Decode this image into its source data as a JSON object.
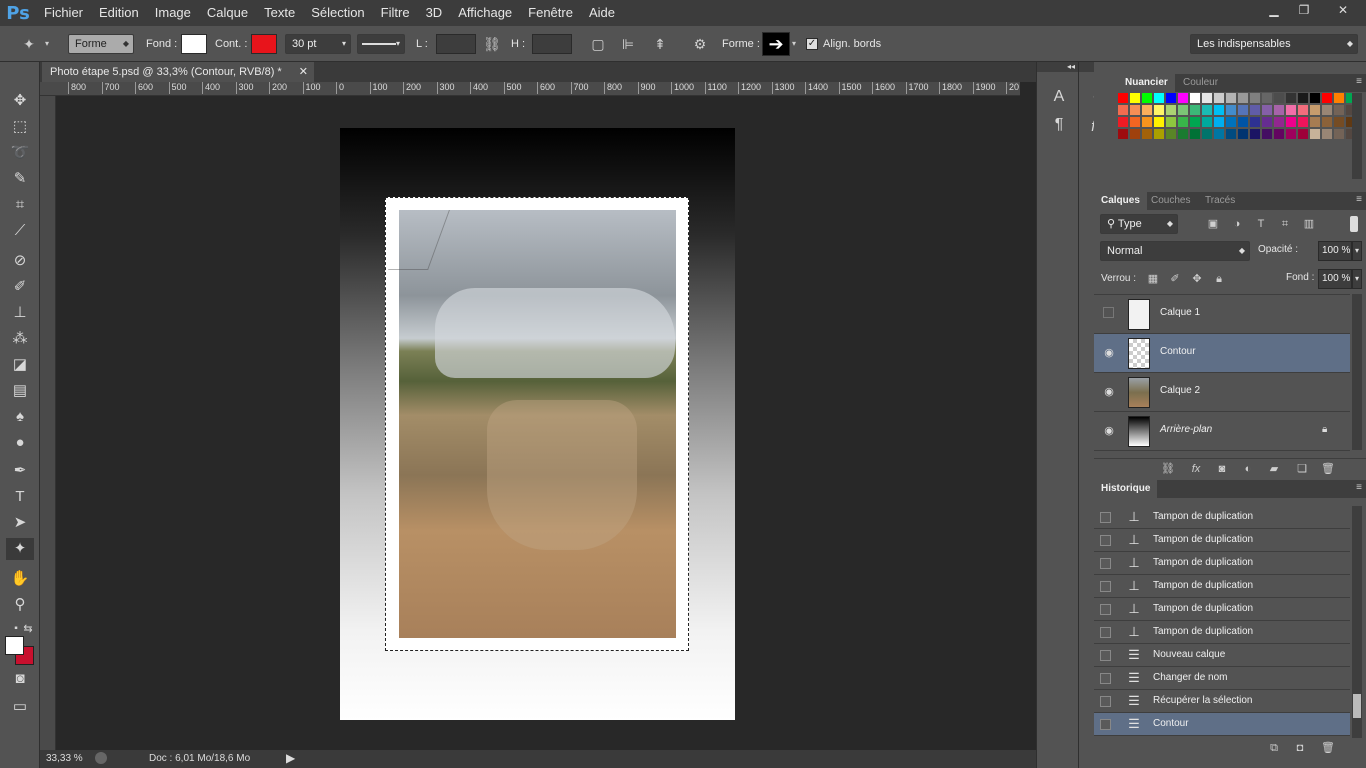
{
  "app": {
    "logo": "Ps"
  },
  "menu": [
    "Fichier",
    "Edition",
    "Image",
    "Calque",
    "Texte",
    "Sélection",
    "Filtre",
    "3D",
    "Affichage",
    "Fenêtre",
    "Aide"
  ],
  "window_controls": [
    "minimize-icon",
    "restore-icon",
    "close-icon"
  ],
  "options": {
    "mode": "Forme",
    "fill_label": "Fond :",
    "stroke_label": "Cont. :",
    "stroke_color": "#e8141b",
    "fill_color": "#ffffff",
    "stroke_width": "30 pt",
    "w_label": "L :",
    "h_label": "H :",
    "shape_label": "Forme :",
    "align_label": "Align. bords",
    "workspace": "Les indispensables"
  },
  "document": {
    "tab_title": "Photo étape 5.psd @ 33,3% (Contour, RVB/8) *",
    "zoom": "33,33 %",
    "doc_info": "Doc : 6,01 Mo/18,6 Mo"
  },
  "ruler_ticks": [
    "800",
    "700",
    "600",
    "500",
    "400",
    "300",
    "200",
    "100",
    "0",
    "100",
    "200",
    "300",
    "400",
    "500",
    "600",
    "700",
    "800",
    "900",
    "1000",
    "1100",
    "1200",
    "1300",
    "1400",
    "1500",
    "1600",
    "1700",
    "1800",
    "1900",
    "20"
  ],
  "swatch_panel": {
    "tabs": [
      "Nuancier",
      "Couleur"
    ],
    "colors": [
      "#ff0000",
      "#ffff00",
      "#00ff00",
      "#00ffff",
      "#0000ff",
      "#ff00ff",
      "#ffffff",
      "#e6e6e6",
      "#cccccc",
      "#b3b3b3",
      "#999999",
      "#808080",
      "#666666",
      "#4d4d4d",
      "#333333",
      "#1a1a1a",
      "#000000",
      "#ff0000",
      "#ff8000",
      "#00a651",
      "#f26c4f",
      "#f68e55",
      "#fbaf5c",
      "#fff467",
      "#acd372",
      "#7cc576",
      "#3bb878",
      "#1abbb4",
      "#00bff3",
      "#438ccb",
      "#5574b9",
      "#605ca8",
      "#855fa8",
      "#a763a9",
      "#f06ea9",
      "#f26d7d",
      "#c69c6d",
      "#998675",
      "#736357",
      "#534741",
      "#ed1c24",
      "#f26522",
      "#f7941d",
      "#fff200",
      "#8dc63f",
      "#39b54a",
      "#00a651",
      "#00a99d",
      "#00aeef",
      "#0072bc",
      "#0054a6",
      "#2e3192",
      "#662d91",
      "#92278f",
      "#ec008c",
      "#ed145b",
      "#a67c52",
      "#8c6239",
      "#754c24",
      "#603913"
    ],
    "colors_b": [
      "#9e0b0f",
      "#a0410d",
      "#a3620a",
      "#aba000",
      "#598527",
      "#1a7b30",
      "#007236",
      "#00746b",
      "#0076a3",
      "#004b80",
      "#003471",
      "#1b1464",
      "#440e62",
      "#630460",
      "#9e005d",
      "#9e0039",
      "#c7b299",
      "#998675",
      "#736357",
      "#534741"
    ]
  },
  "layers_panel": {
    "tabs": [
      "Calques",
      "Couches",
      "Tracés"
    ],
    "filter": "Type",
    "blend_mode": "Normal",
    "opacity_label": "Opacité :",
    "opacity": "100 %",
    "lock_label": "Verrou :",
    "fill_label": "Fond :",
    "fill": "100 %",
    "layers": [
      {
        "name": "Calque 1",
        "visible": false,
        "selected": false,
        "italic": false
      },
      {
        "name": "Contour",
        "visible": true,
        "selected": true,
        "italic": false
      },
      {
        "name": "Calque 2",
        "visible": true,
        "selected": false,
        "italic": false
      },
      {
        "name": "Arrière-plan",
        "visible": true,
        "selected": false,
        "italic": true,
        "locked": true
      }
    ]
  },
  "history_panel": {
    "tab": "Historique",
    "items": [
      {
        "name": "Tampon de duplication",
        "icon": "stamp-icon"
      },
      {
        "name": "Tampon de duplication",
        "icon": "stamp-icon"
      },
      {
        "name": "Tampon de duplication",
        "icon": "stamp-icon"
      },
      {
        "name": "Tampon de duplication",
        "icon": "stamp-icon"
      },
      {
        "name": "Tampon de duplication",
        "icon": "stamp-icon"
      },
      {
        "name": "Tampon de duplication",
        "icon": "stamp-icon"
      },
      {
        "name": "Nouveau calque",
        "icon": "document-icon"
      },
      {
        "name": "Changer de nom",
        "icon": "document-icon"
      },
      {
        "name": "Récupérer la sélection",
        "icon": "document-icon"
      },
      {
        "name": "Contour",
        "icon": "document-icon",
        "selected": true
      }
    ]
  }
}
